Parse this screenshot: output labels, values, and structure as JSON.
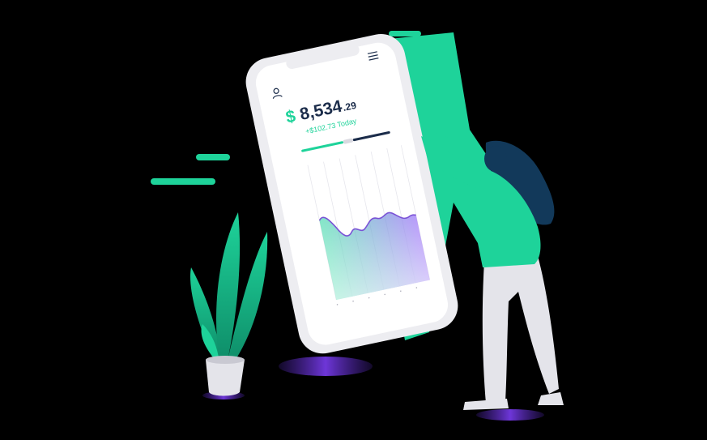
{
  "balance": {
    "currency": "$",
    "amount": "8,534",
    "cents": ".29",
    "change": "+$102.73 Today"
  },
  "progress": {
    "fraction": 0.47
  },
  "icons": {
    "profile": "user-icon",
    "menu": "hamburger-menu-icon"
  },
  "colors": {
    "accent_green": "#1ed39a",
    "navy": "#1b2c4a",
    "phone_body": "#ededf1",
    "screen": "#ffffff",
    "purple": "#8a5cf6"
  }
}
